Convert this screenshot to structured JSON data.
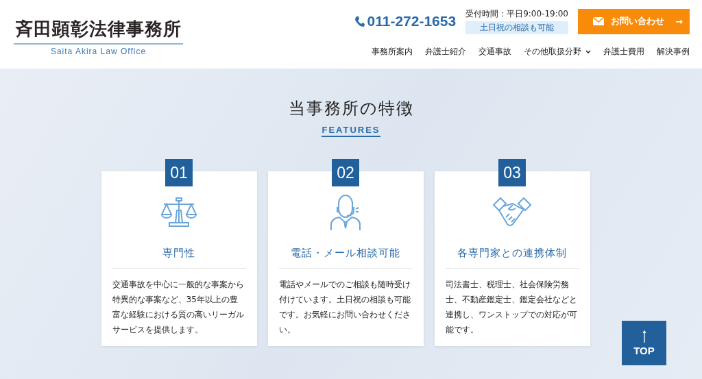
{
  "header": {
    "logo": {
      "name": "斉田顕彰法律事務所",
      "subtitle": "Saita Akira Law Office"
    },
    "phone": "011-272-1653",
    "hours": "受付時間：平日9:00-19:00",
    "hours_note": "土日祝の相談も可能",
    "contact_button": {
      "label": "お問い合わせ",
      "arrow": "→"
    },
    "nav": [
      {
        "label": "事務所案内",
        "kind": "link"
      },
      {
        "label": "弁護士紹介",
        "kind": "link"
      },
      {
        "label": "交通事故",
        "kind": "link"
      },
      {
        "label": "その他取扱分野",
        "kind": "dropdown"
      },
      {
        "label": "弁護士費用",
        "kind": "link"
      },
      {
        "label": "解決事例",
        "kind": "link"
      }
    ]
  },
  "features": {
    "title": "当事務所の特徴",
    "subtitle": "FEATURES",
    "cards": [
      {
        "number": "01",
        "title": "専門性",
        "text": "交通事故を中心に一般的な事案から特異的な事案など、35年以上の豊富な経験における質の高いリーガルサービスを提供します。"
      },
      {
        "number": "02",
        "title": "電話・メール相談可能",
        "text": "電話やメールでのご相談も随時受け付けています。土日祝の相談も可能です。お気軽にお問い合わせください。"
      },
      {
        "number": "03",
        "title": "各専門家との連携体制",
        "text": "司法書士、税理士、社会保険労務士、不動産鑑定士、鑑定会社などと連携し、ワンストップでの対応が可能です。"
      }
    ]
  },
  "top_button": {
    "label": "TOP"
  }
}
